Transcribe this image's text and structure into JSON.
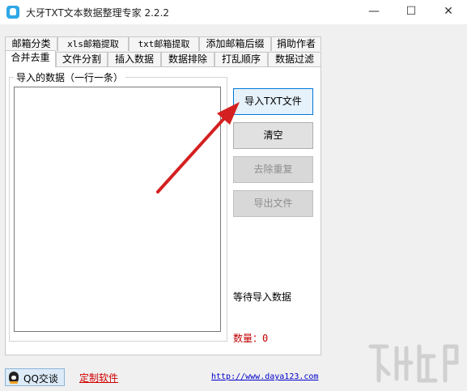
{
  "window": {
    "title": "大牙TXT文本数据整理专家 2.2.2",
    "minimize_symbol": "—",
    "maximize_symbol": "☐",
    "close_symbol": "✕"
  },
  "tabs_top_row": [
    {
      "label": "邮箱分类"
    },
    {
      "label": "xls邮箱提取"
    },
    {
      "label": "txt邮箱提取"
    },
    {
      "label": "添加邮箱后缀"
    },
    {
      "label": "捐助作者"
    }
  ],
  "tabs_bottom_row": [
    {
      "label": "合并去重",
      "active": true
    },
    {
      "label": "文件分割"
    },
    {
      "label": "插入数据"
    },
    {
      "label": "数据排除"
    },
    {
      "label": "打乱顺序"
    },
    {
      "label": "数据过滤"
    }
  ],
  "import_group": {
    "label": "导入的数据（一行一条）",
    "textarea_value": ""
  },
  "buttons": {
    "import_txt": "导入TXT文件",
    "clear": "清空",
    "dedupe": "去除重复",
    "export": "导出文件"
  },
  "status": {
    "waiting_text": "等待导入数据",
    "count_label": "数量：",
    "count_value": "0"
  },
  "footer": {
    "qq_button": "QQ交谈",
    "custom_software_link": "定制软件",
    "website_link": "http://www.daya123.com"
  },
  "colors": {
    "annotation_arrow": "#d42020",
    "count_text": "#c00000",
    "custom_link": "#d00000",
    "website_link": "#0000cc"
  }
}
